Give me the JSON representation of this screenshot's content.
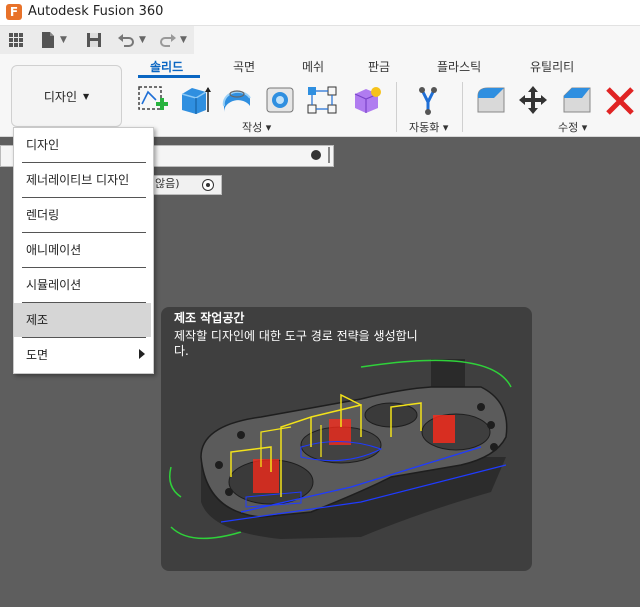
{
  "window": {
    "title": "Autodesk Fusion 360",
    "app_icon_letter": "F"
  },
  "quickbar": {
    "icons": [
      "grid-icon",
      "file-icon",
      "save-icon",
      "undo-icon",
      "redo-icon"
    ]
  },
  "ribbon": {
    "workspace_button": "디자인",
    "tabs": [
      "솔리드",
      "곡면",
      "메쉬",
      "판금",
      "플라스틱",
      "유틸리티"
    ],
    "active_tab": "솔리드",
    "groups": {
      "create": "작성",
      "automate": "자동화",
      "modify": "수정"
    }
  },
  "browser": {
    "component_text": "않음)"
  },
  "workspace_menu": {
    "items": [
      "디자인",
      "제너레이티브 디자인",
      "렌더링",
      "애니메이션",
      "시뮬레이션",
      "제조",
      "도면"
    ],
    "highlighted": "제조"
  },
  "tooltip": {
    "title": "제조 작업공간",
    "description": "제작할 디자인에 대한 도구 경로 전략을 생성합니다."
  },
  "colors": {
    "accent": "#0a66c2",
    "delete_red": "#e02424",
    "toolpath_yellow": "#f2e21a",
    "toolpath_blue": "#1f3bff",
    "toolpath_green": "#2fd13a",
    "stock_red": "#ff2a1a"
  }
}
